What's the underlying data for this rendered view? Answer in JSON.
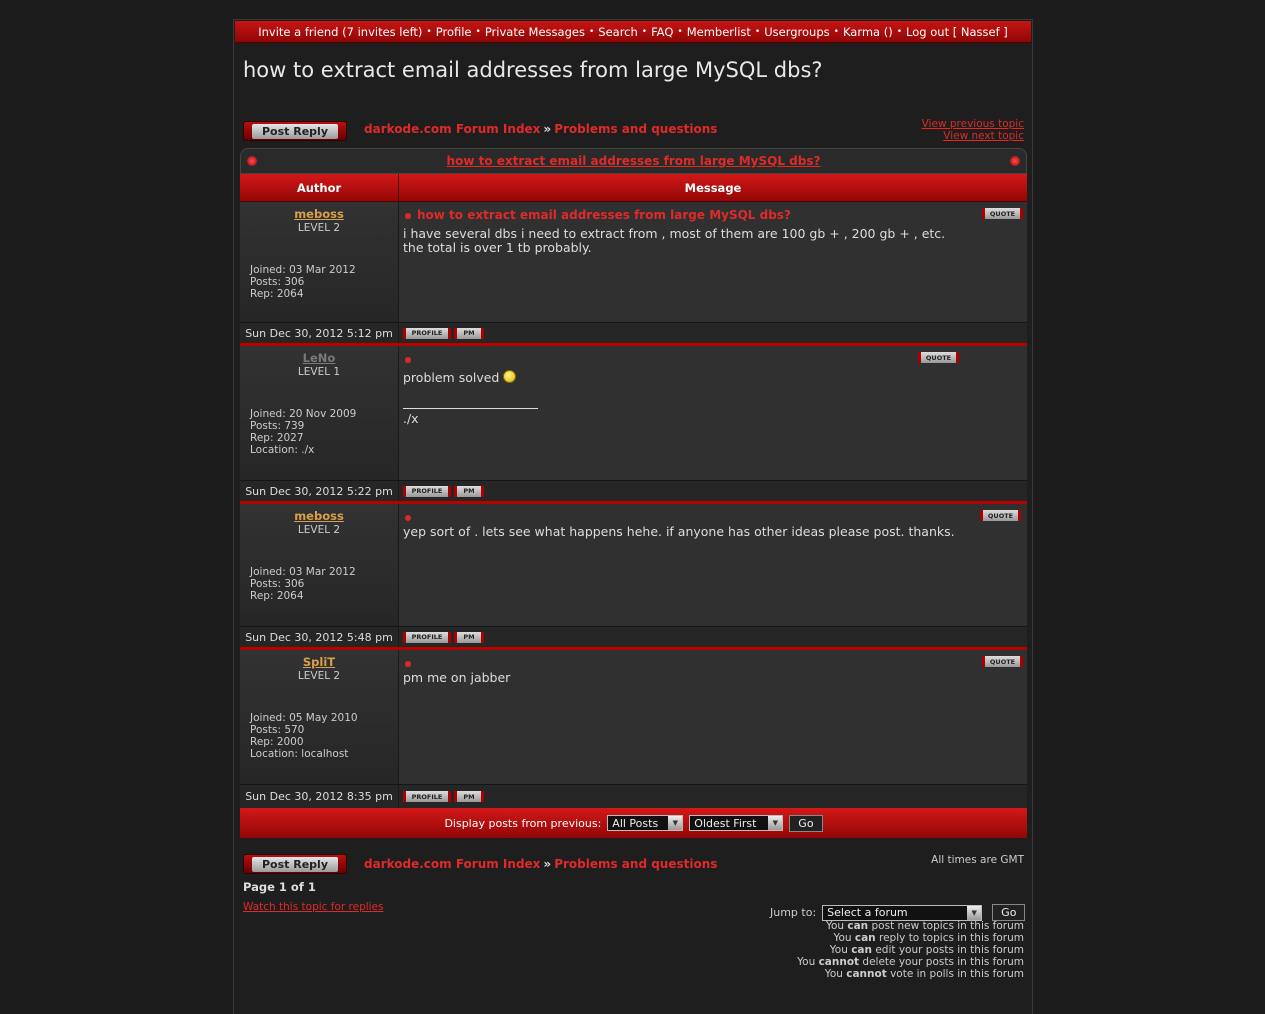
{
  "nav": {
    "items": [
      "Invite a friend (7 invites left)",
      "Profile",
      "Private Messages",
      "Search",
      "FAQ",
      "Memberlist",
      "Usergroups",
      "Karma ()",
      "Log out [ Nassef ]"
    ],
    "separator": "•"
  },
  "page_title": "how to extract email addresses from large MySQL dbs?",
  "post_reply_label": "Post Reply",
  "breadcrumb": {
    "index": "darkode.com Forum Index",
    "separator": "»",
    "forum": "Problems and questions"
  },
  "topic_nav": {
    "previous": "View previous topic",
    "next": "View next topic"
  },
  "caption": "how to extract email addresses from large MySQL dbs?",
  "headers": {
    "author": "Author",
    "message": "Message"
  },
  "buttons": {
    "quote": "QUOTE",
    "profile": "PROFILE",
    "pm": "PM"
  },
  "posts": [
    {
      "username": "meboss",
      "name_color": "#d9a04a",
      "level": "LEVEL 2",
      "info": [
        "Joined: 03 Mar 2012",
        "Posts: 306",
        "Rep: 2064"
      ],
      "title": "how to extract email addresses from large MySQL dbs?",
      "body": [
        "i have several dbs i need to extract from , most of them are 100 gb + , 200 gb + , etc.",
        "the total is over 1 tb probably."
      ],
      "date": "Sun Dec 30, 2012 5:12 pm"
    },
    {
      "username": "LeNo",
      "name_color": "#7a7a7a",
      "level": "LEVEL 1",
      "info": [
        "Joined: 20 Nov 2009",
        "Posts: 739",
        "Rep: 2027",
        "Location: ./x"
      ],
      "title": "",
      "body": [
        "problem solved"
      ],
      "signature": "./x",
      "date": "Sun Dec 30, 2012 5:22 pm"
    },
    {
      "username": "meboss",
      "name_color": "#d9a04a",
      "level": "LEVEL 2",
      "info": [
        "Joined: 03 Mar 2012",
        "Posts: 306",
        "Rep: 2064"
      ],
      "title": "",
      "body": [
        "yep sort of . lets see what happens hehe. if anyone has other ideas please post. thanks."
      ],
      "date": "Sun Dec 30, 2012 5:48 pm"
    },
    {
      "username": "SpliT",
      "name_color": "#d9a04a",
      "level": "LEVEL 2",
      "info": [
        "Joined: 05 May 2010",
        "Posts: 570",
        "Rep: 2000",
        "Location: localhost"
      ],
      "title": "",
      "body": [
        "pm me on jabber"
      ],
      "date": "Sun Dec 30, 2012 8:35 pm"
    }
  ],
  "sort_bar": {
    "label": "Display posts from previous:",
    "posts_select": "All Posts",
    "order_select": "Oldest First",
    "go": "Go"
  },
  "timezone": "All times are GMT",
  "pagination": "Page 1 of 1",
  "watch_topic": "Watch this topic for replies",
  "jump": {
    "label": "Jump to:",
    "select": "Select a forum",
    "go": "Go"
  },
  "permissions": [
    [
      "You ",
      "can",
      " post new topics in this forum"
    ],
    [
      "You ",
      "can",
      " reply to topics in this forum"
    ],
    [
      "You ",
      "can",
      " edit your posts in this forum"
    ],
    [
      "You ",
      "cannot",
      " delete your posts in this forum"
    ],
    [
      "You ",
      "cannot",
      " vote in polls in this forum"
    ]
  ],
  "colors": {
    "accent": "#e02a2a",
    "bar": "#c81414"
  }
}
